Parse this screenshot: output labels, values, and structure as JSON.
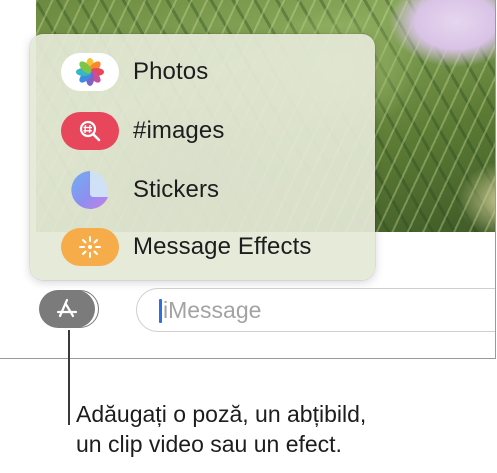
{
  "menu": {
    "items": [
      {
        "label": "Photos",
        "icon": "photos-icon"
      },
      {
        "label": "#images",
        "icon": "images-search-icon"
      },
      {
        "label": "Stickers",
        "icon": "sticker-icon"
      },
      {
        "label": "Message Effects",
        "icon": "sparkle-effects-icon"
      }
    ]
  },
  "composer": {
    "apps_button_icon": "app-store-icon",
    "placeholder": "iMessage"
  },
  "caption": {
    "line1": "Adăugați o poză, un abțibild,",
    "line2": "un clip video sau un efect."
  },
  "colors": {
    "images_icon_bg": "#e8475b",
    "effects_icon_bg": "#f6ac48",
    "cursor": "#2b6fe0",
    "apps_button_bg": "#7b7b7b"
  }
}
